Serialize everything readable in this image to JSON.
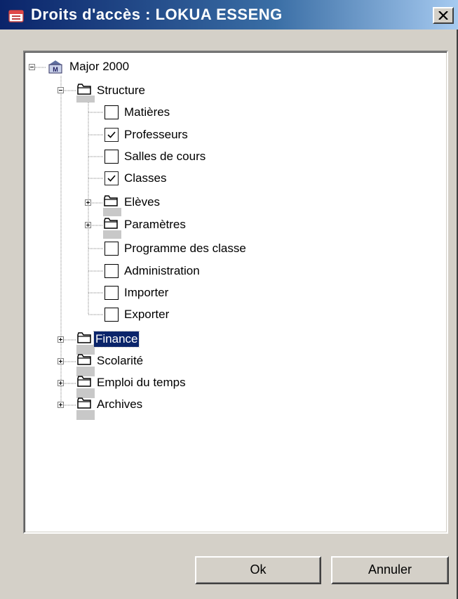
{
  "window": {
    "title": "Droits d'accès : LOKUA ESSENG"
  },
  "tree": {
    "root": {
      "label": "Major 2000",
      "icon": "app-logo-icon",
      "expanded": true
    },
    "structure": {
      "label": "Structure",
      "expanded": true,
      "items": [
        {
          "label": "Matières",
          "type": "checkbox",
          "checked": false
        },
        {
          "label": "Professeurs",
          "type": "checkbox",
          "checked": true
        },
        {
          "label": "Salles de cours",
          "type": "checkbox",
          "checked": false
        },
        {
          "label": "Classes",
          "type": "checkbox",
          "checked": true
        },
        {
          "label": "Elèves",
          "type": "folder",
          "expanded": false
        },
        {
          "label": "Paramètres",
          "type": "folder",
          "expanded": false
        },
        {
          "label": "Programme des classe",
          "type": "checkbox",
          "checked": false
        },
        {
          "label": "Administration",
          "type": "checkbox",
          "checked": false
        },
        {
          "label": "Importer",
          "type": "checkbox",
          "checked": false
        },
        {
          "label": "Exporter",
          "type": "checkbox",
          "checked": false
        }
      ]
    },
    "top_folders": [
      {
        "label": "Finance",
        "selected": true
      },
      {
        "label": "Scolarité",
        "selected": false
      },
      {
        "label": "Emploi du temps",
        "selected": false
      },
      {
        "label": "Archives",
        "selected": false
      }
    ]
  },
  "buttons": {
    "ok_label": "Ok",
    "cancel_label": "Annuler"
  },
  "colors": {
    "titlebar_start": "#0a246a",
    "titlebar_end": "#a6caf0",
    "selection": "#0a246a",
    "face": "#d4d0c8"
  }
}
